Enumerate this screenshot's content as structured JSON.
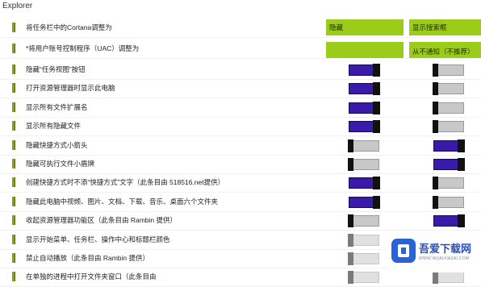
{
  "section_title": "Explorer",
  "header_row": {
    "label": "将任务栏中的Cortana调整为",
    "col1": "隐藏",
    "col2": "显示搜索框"
  },
  "uac_row": {
    "label": "*将用户账号控制程序（UAC）调整为",
    "col1": "",
    "col2": "从不通知（不推荐）"
  },
  "toggle_rows": [
    {
      "label": "隐藏“任务视图”按钮",
      "col1": "on",
      "col2": "off"
    },
    {
      "label": "打开资源管理器时显示此电脑",
      "col1": "on",
      "col2": "off"
    },
    {
      "label": "显示所有文件扩展名",
      "col1": "on",
      "col2": "off"
    },
    {
      "label": "显示所有隐藏文件",
      "col1": "on",
      "col2": "off"
    },
    {
      "label": "隐藏快捷方式小箭头",
      "col1": "off",
      "col2": "on"
    },
    {
      "label": "隐藏可执行文件小盾牌",
      "col1": "off",
      "col2": "on"
    },
    {
      "label": "创建快捷方式时不添“快捷方式”文字（此条目由 518516.net提供）",
      "col1": "on",
      "col2": "off"
    },
    {
      "label": "隐藏此电脑中视频、图片、文档、下载、音乐、桌面六个文件夹",
      "col1": "on",
      "col2": "off"
    },
    {
      "label": "收起资源管理器功能区（此条目由 Rambin 提供）",
      "col1": "off",
      "col2": "on"
    },
    {
      "label": "显示开始菜单、任务栏、操作中心和标题栏颜色",
      "col1": "off",
      "col2": "off"
    },
    {
      "label": "禁止自动播放（此条目由 Rambin 提供）",
      "col1": "off",
      "col2": "off"
    },
    {
      "label": "在单独的进程中打开文件夹窗口（此条目由",
      "col1": "off",
      "col2": "off"
    }
  ],
  "watermark": {
    "brand": "吾爱下载网",
    "url": "WWW.WUAIXIAZAI.COM",
    "logo_icon": "box-logo-icon"
  },
  "colors": {
    "header_cell": "#9bcc1a",
    "toggle_on": "#3a1aa8",
    "toggle_off": "#c8c8c8",
    "bullet": "#8f9a1c"
  }
}
